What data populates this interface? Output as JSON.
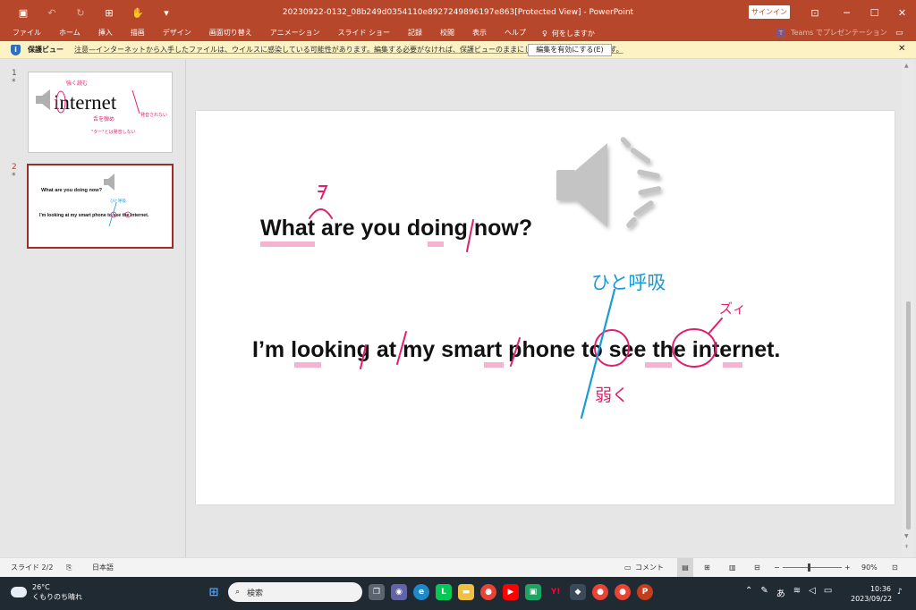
{
  "window": {
    "title": "20230922-0132_08b249d0354110e8927249896197e863[Protected View]  -  PowerPoint",
    "signin_label": "サインイン",
    "minimize": "─",
    "maximize": "☐",
    "close": "✕"
  },
  "qat": {
    "save_icon": "▣",
    "undo_icon": "↶",
    "redo_icon": "↻",
    "present_icon": "⊞",
    "touch_icon": "✋",
    "more_icon": "▾"
  },
  "ribbon": {
    "tabs": [
      "ファイル",
      "ホーム",
      "挿入",
      "描画",
      "デザイン",
      "画面切り替え",
      "アニメーション",
      "スライド ショー",
      "記録",
      "校閲",
      "表示",
      "ヘルプ"
    ],
    "tell_me": "何をしますか",
    "teams_label": "Teams でプレゼンテーション",
    "accent_color": "#b7472a"
  },
  "protected_view": {
    "title": "保護ビュー",
    "message": "注意—インターネットから入手したファイルは、ウイルスに感染している可能性があります。編集する必要がなければ、保護ビューのままにしておくことをお勧めします。",
    "enable_button": "編集を有効にする(E)",
    "close": "✕"
  },
  "thumbnails": [
    {
      "number": "1",
      "star": "*",
      "word": "internet",
      "notes": [
        "強く読む",
        "発音されない",
        "舌を弾め",
        "\"ター\"とは発音しない"
      ]
    },
    {
      "number": "2",
      "star": "*",
      "line1": "What are you doing now?",
      "line2": "I'm looking at my smart phone to see the internet.",
      "note": "ひと呼吸"
    }
  ],
  "slide": {
    "line1": "What are you doing now?",
    "line2": "I’m looking at my smart phone to see the internet.",
    "annotations": {
      "u_mark": "ウ",
      "breath": "ひと呼吸",
      "weak": "弱く",
      "zui": "ズィ"
    },
    "ink_pink": "#e0206e",
    "ink_blue": "#1a9ad6"
  },
  "statusbar": {
    "slide_indicator": "スライド 2/2",
    "language": "日本語",
    "comments": "コメント",
    "zoom_minus": "−",
    "zoom_plus": "+",
    "zoom": "90%"
  },
  "taskbar": {
    "temperature": "26°C",
    "weather": "くもりのち晴れ",
    "search_placeholder": "検索",
    "time": "10:36",
    "date": "2023/09/22",
    "ime": "あ"
  }
}
